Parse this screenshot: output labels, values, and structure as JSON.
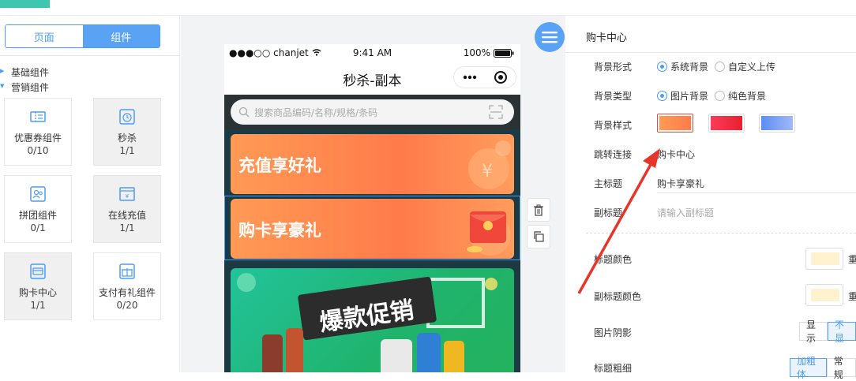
{
  "left": {
    "tabs": [
      "页面",
      "组件"
    ],
    "groups": [
      "基础组件",
      "营销组件"
    ],
    "components": [
      {
        "label": "优惠券组件",
        "count": "0/10"
      },
      {
        "label": "秒杀",
        "count": "1/1"
      },
      {
        "label": "拼团组件",
        "count": "0/1"
      },
      {
        "label": "在线充值",
        "count": "1/1"
      },
      {
        "label": "购卡中心",
        "count": "1/1"
      },
      {
        "label": "支付有礼组件",
        "count": "0/20"
      }
    ]
  },
  "phone": {
    "carrier": "●●●○○ chanjet",
    "time": "9:41 AM",
    "battery": "100%",
    "title": "秒杀-副本",
    "search_placeholder": "搜索商品编码/名称/规格/条码",
    "banners": [
      "充值享好礼",
      "购卡享豪礼"
    ],
    "promo_text": "爆款促销"
  },
  "right": {
    "title": "购卡中心",
    "labels": {
      "bg_form": "背景形式",
      "bg_type": "背景类型",
      "bg_style": "背景样式",
      "jump_link": "跳转连接",
      "main_title": "主标题",
      "sub_title": "副标题",
      "title_color": "标题颜色",
      "sub_title_color": "副标题颜色",
      "img_shadow": "图片阴影",
      "title_weight": "标题粗细"
    },
    "bg_form_options": [
      "系统背景",
      "自定义上传"
    ],
    "bg_type_options": [
      "图片背景",
      "纯色背景"
    ],
    "jump_link_value": "购卡中心",
    "main_title_value": "购卡享豪礼",
    "sub_title_placeholder": "请输入副标题",
    "reset_label": "重",
    "shadow_options": [
      "显示",
      "不显"
    ],
    "weight_options": [
      "加粗体",
      "常规"
    ],
    "colors": {
      "accent": "#4b9cf5",
      "title_color": "#fff3cf"
    }
  }
}
